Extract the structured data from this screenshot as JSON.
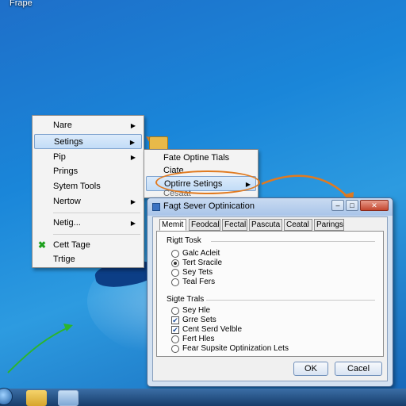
{
  "desktop": {
    "label": "Frape"
  },
  "context_menu": {
    "items": [
      {
        "label": "Nare",
        "has_submenu": true
      },
      {
        "label": "Setings",
        "has_submenu": true,
        "highlighted": true
      },
      {
        "label": "Pip",
        "has_submenu": true
      },
      {
        "label": "Prings",
        "has_submenu": false
      },
      {
        "label": "Sytem Tools",
        "has_submenu": false
      },
      {
        "label": "Nertow",
        "has_submenu": true
      },
      {
        "label": "Netig...",
        "has_submenu": true
      },
      {
        "label": "Cett Tage",
        "has_submenu": false,
        "icon": "check-icon"
      },
      {
        "label": "Trtige",
        "has_submenu": false
      }
    ]
  },
  "submenu": {
    "items": [
      {
        "label": "Fate Optine Tials"
      },
      {
        "label": "Ciate"
      },
      {
        "label": "Optirre Setings",
        "highlighted": true,
        "has_submenu": true
      },
      {
        "label": "Cesaat"
      }
    ]
  },
  "dialog": {
    "title": "Fagt Sever Optinication",
    "tabs": [
      "Memit",
      "Feodcal",
      "Fectal",
      "Pascuta",
      "Ceatal",
      "Parings"
    ],
    "active_tab": 0,
    "group1": {
      "label": "Rigtt Tosk",
      "options": [
        {
          "label": "Galc Acleit",
          "checked": false
        },
        {
          "label": "Tert Sracile",
          "checked": true
        },
        {
          "label": "Sey Tets",
          "checked": false
        },
        {
          "label": "Teal Fers",
          "checked": false
        }
      ]
    },
    "group2": {
      "label": "Sigte Trals",
      "options": [
        {
          "label": "Sey Hle",
          "type": "radio",
          "checked": false
        },
        {
          "label": "Grre Sets",
          "type": "check",
          "checked": true
        },
        {
          "label": "Cent Serd Velble",
          "type": "check",
          "checked": true
        },
        {
          "label": "Fert Hles",
          "type": "radio",
          "checked": false
        },
        {
          "label": "Fear Supsite Optinization Lets",
          "type": "radio",
          "checked": false
        }
      ]
    },
    "buttons": {
      "ok": "OK",
      "cancel": "Cacel"
    }
  },
  "colors": {
    "accent_orange": "#e07a20",
    "highlight_blue": "#c2dcf7",
    "desktop_blue": "#1a86d9"
  }
}
